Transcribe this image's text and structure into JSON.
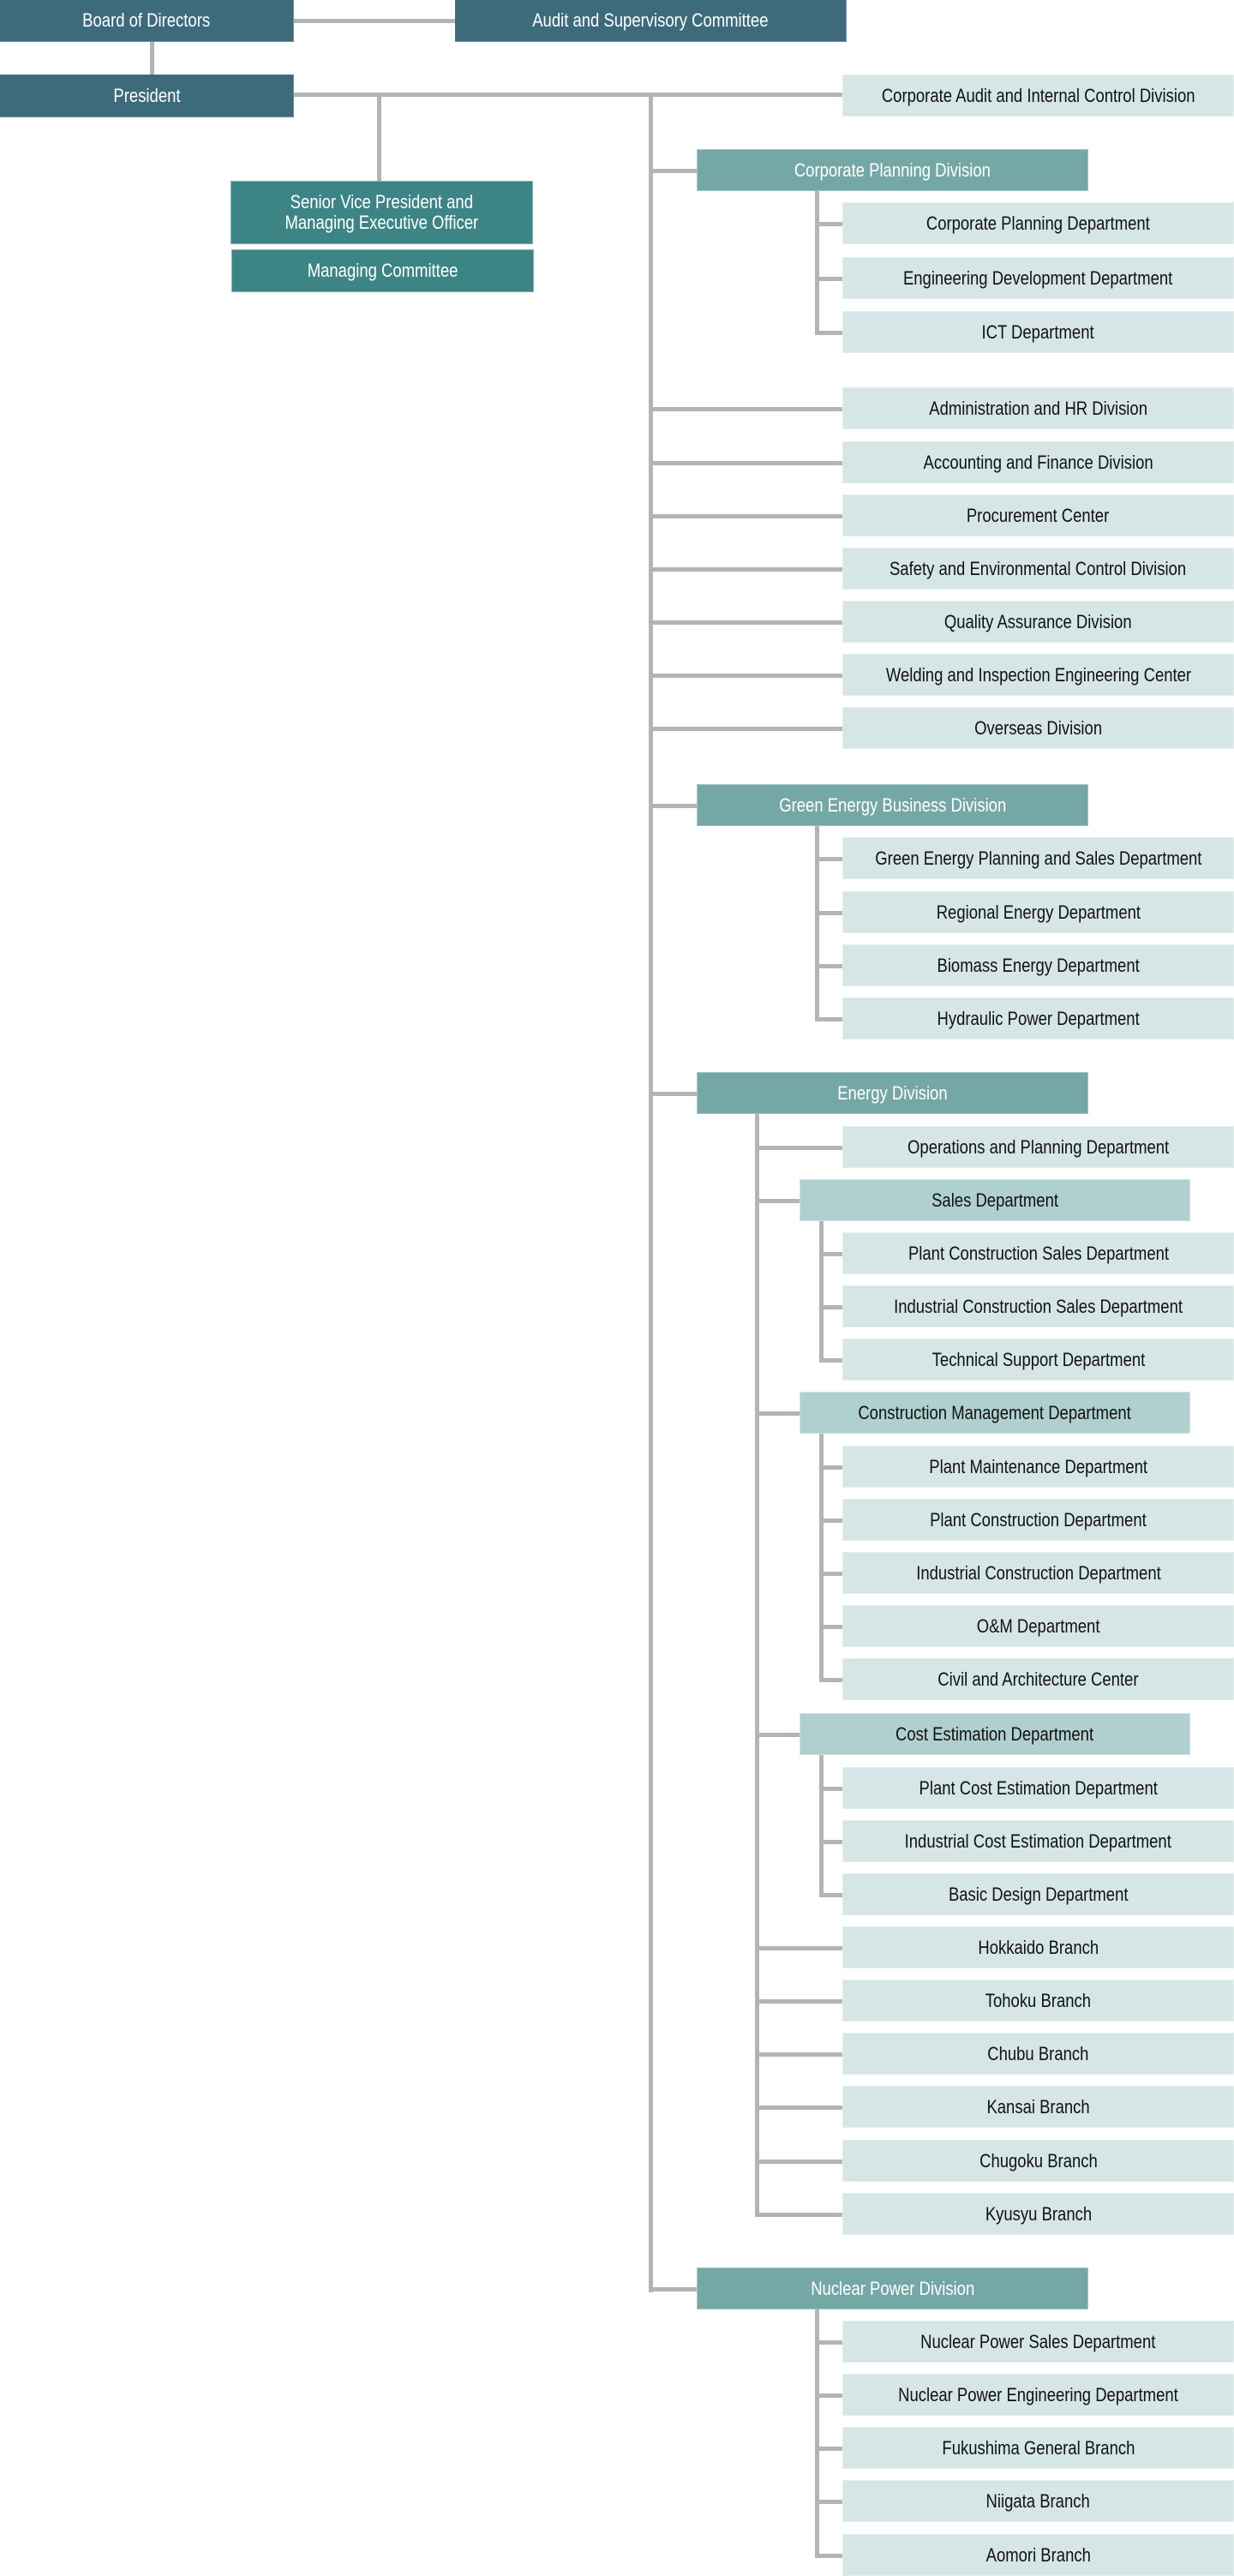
{
  "title": "Organization Chart",
  "colors": {
    "executive": "#3e6b7c",
    "officer": "#3d8585",
    "division": "#75a7a6",
    "subgroup": "#b0cfcf",
    "unit": "#d6e5e5",
    "connector": "#b4b4b4"
  },
  "top": {
    "board": "Board of Directors",
    "audit_committee": "Audit and Supervisory Committee",
    "president": "President",
    "svp_line1": "Senior Vice President and",
    "svp_line2": "Managing Executive Officer",
    "managing_committee": "Managing Committee"
  },
  "corporate_audit": "Corporate Audit and Internal Control Division",
  "corporate_planning": {
    "label": "Corporate Planning Division",
    "children": [
      "Corporate Planning Department",
      "Engineering Development Department",
      "ICT Department"
    ]
  },
  "staff_divisions": [
    "Administration and HR Division",
    "Accounting and Finance Division",
    "Procurement Center",
    "Safety and Environmental Control Division",
    "Quality Assurance Division",
    "Welding and Inspection Engineering Center",
    "Overseas Division"
  ],
  "green_energy": {
    "label": "Green Energy Business Division",
    "children": [
      "Green Energy Planning and Sales Department",
      "Regional Energy Department",
      "Biomass Energy Department",
      "Hydraulic Power Department"
    ]
  },
  "energy": {
    "label": "Energy Division",
    "operations": "Operations and Planning Department",
    "sales": {
      "label": "Sales Department",
      "children": [
        "Plant Construction Sales Department",
        "Industrial Construction Sales Department",
        "Technical Support Department"
      ]
    },
    "construction_management": {
      "label": "Construction Management Department",
      "children": [
        "Plant Maintenance Department",
        "Plant Construction Department",
        "Industrial Construction Department",
        "O&M Department",
        "Civil and Architecture Center"
      ]
    },
    "cost_estimation": {
      "label": "Cost Estimation Department",
      "children": [
        "Plant Cost Estimation Department",
        "Industrial Cost Estimation Department",
        "Basic Design Department"
      ]
    },
    "branches": [
      "Hokkaido Branch",
      "Tohoku Branch",
      "Chubu Branch",
      "Kansai Branch",
      "Chugoku Branch",
      "Kyusyu Branch"
    ]
  },
  "nuclear": {
    "label": "Nuclear Power Division",
    "children": [
      "Nuclear Power Sales Department",
      "Nuclear Power Engineering Department",
      "Fukushima General Branch",
      "Niigata Branch",
      "Aomori Branch"
    ]
  }
}
